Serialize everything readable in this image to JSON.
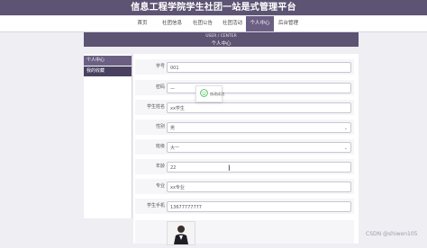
{
  "app": {
    "title": "信息工程学院学生社团一站是式管理平台"
  },
  "nav": {
    "items": [
      {
        "label": "首页",
        "active": false
      },
      {
        "label": "社团信息",
        "active": false
      },
      {
        "label": "社团公告",
        "active": false
      },
      {
        "label": "社团活动",
        "active": false
      },
      {
        "label": "个人中心",
        "active": true
      },
      {
        "label": "后台管理",
        "active": false
      }
    ]
  },
  "banner": {
    "crumb": "USER / CENTER",
    "title": "个人中心"
  },
  "sidebar": {
    "head": "个人中心",
    "sub": "我的收藏"
  },
  "form": {
    "fields": [
      {
        "label": "学号",
        "value": "001",
        "type": "text"
      },
      {
        "label": "密码",
        "value": "—",
        "type": "text"
      },
      {
        "label": "学生姓名",
        "value": "xx学生",
        "type": "text"
      },
      {
        "label": "性别",
        "value": "男",
        "type": "select"
      },
      {
        "label": "班级",
        "value": "大一",
        "type": "select"
      },
      {
        "label": "年龄",
        "value": "22",
        "type": "text"
      },
      {
        "label": "专业",
        "value": "xx专业",
        "type": "text"
      },
      {
        "label": "学生手机",
        "value": "13677777777",
        "type": "text"
      }
    ]
  },
  "toast": {
    "message": "修改成功",
    "icon": "smiley-icon",
    "color": "#2fb344"
  },
  "watermark": {
    "text": "CSDN @shiwen105"
  },
  "colors": {
    "primary": "#5d5373",
    "accent": "#6b6083"
  }
}
